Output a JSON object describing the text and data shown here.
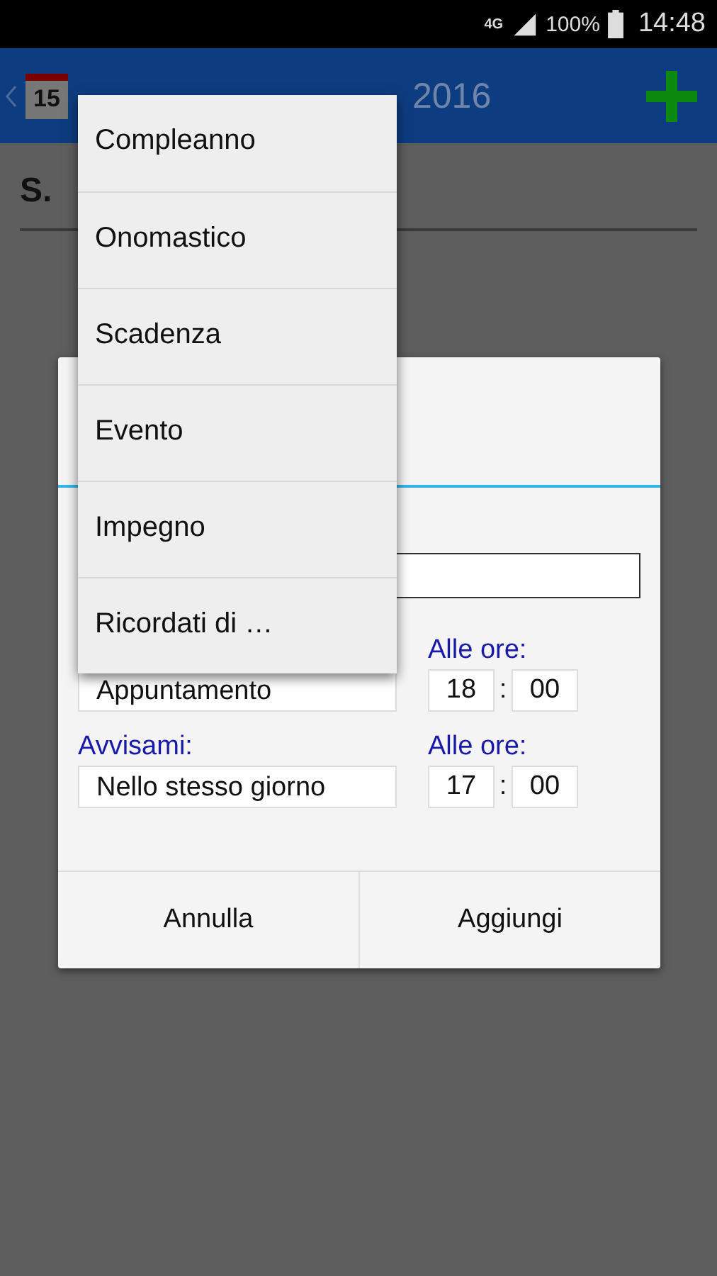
{
  "status_bar": {
    "network": "4G",
    "battery": "100%",
    "time": "14:48"
  },
  "header": {
    "calendar_day": "15",
    "title_visible": "2016"
  },
  "saint": "S.",
  "dialog": {
    "time_label_1": "Alle ore:",
    "type_value": "Appuntamento",
    "hour_1": "18",
    "minute_1": "00",
    "separator": ":",
    "notify_label": "Avvisami:",
    "notify_value": "Nello stesso giorno",
    "time_label_2": "Alle ore:",
    "hour_2": "17",
    "minute_2": "00",
    "buttons": [
      "Annulla",
      "Aggiungi"
    ]
  },
  "menu": [
    "Compleanno",
    "Onomastico",
    "Scadenza",
    "Evento",
    "Impegno",
    "Ricordati di …"
  ]
}
